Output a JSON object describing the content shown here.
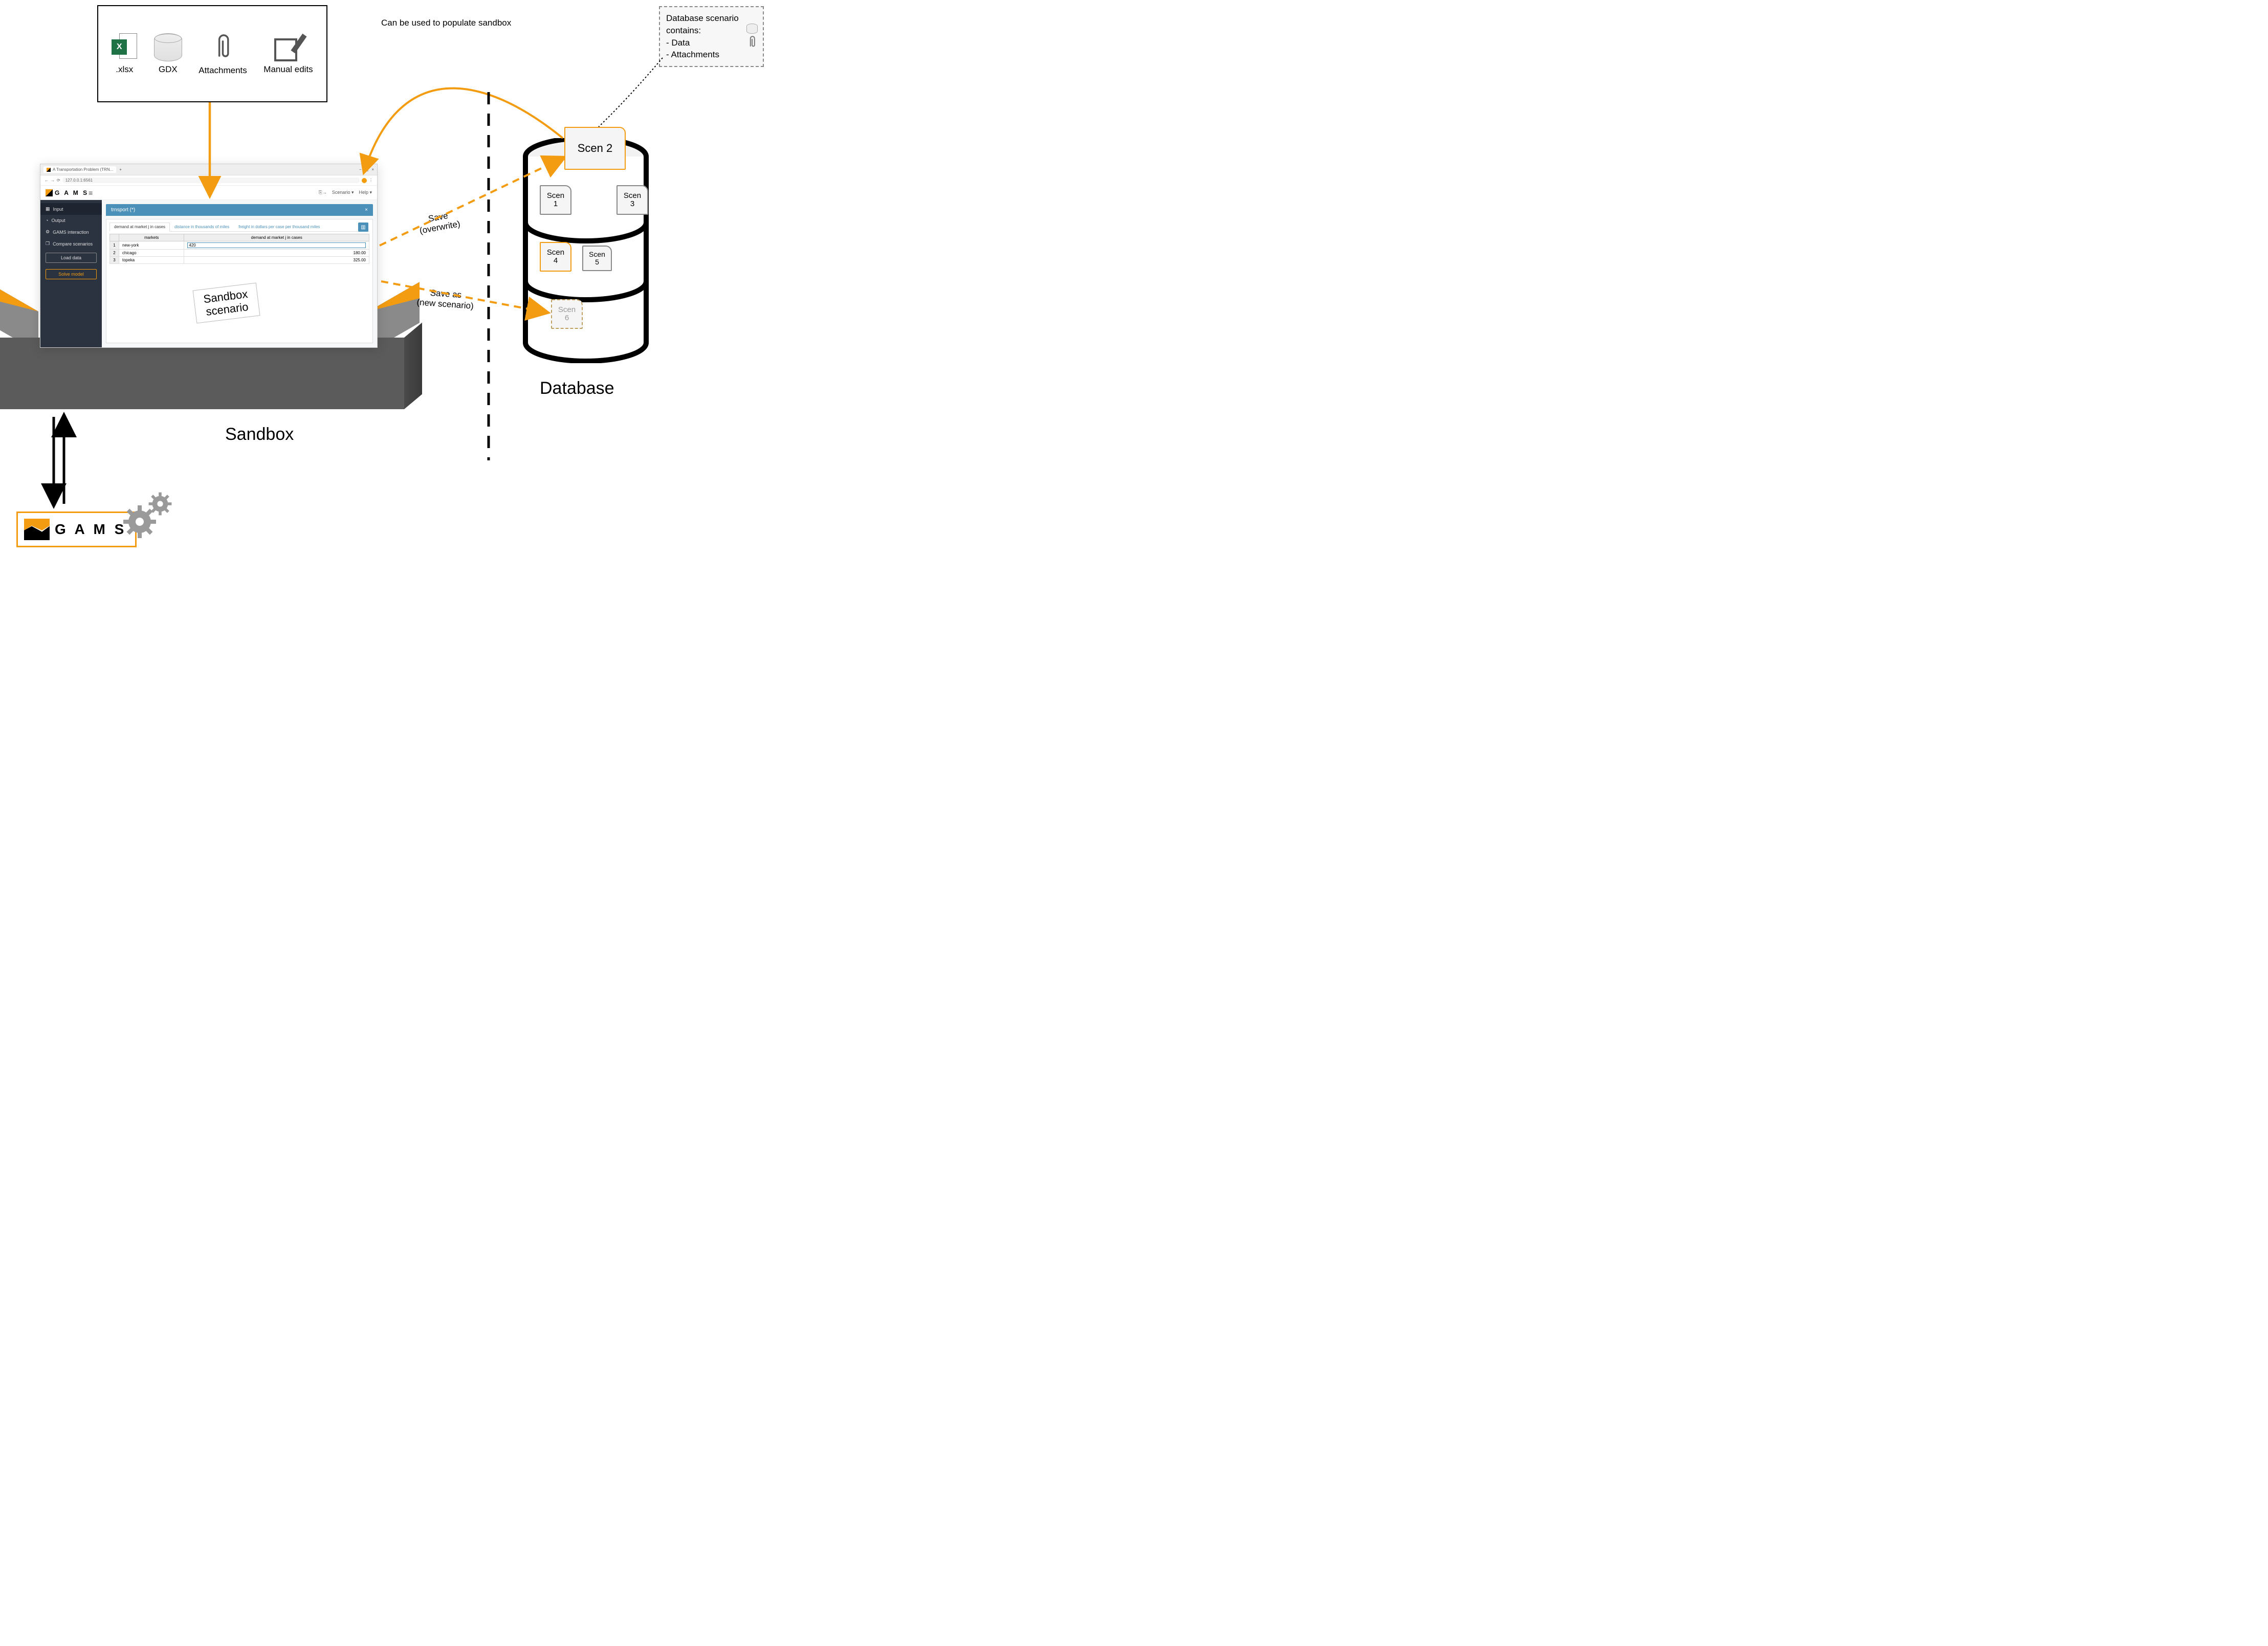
{
  "input_sources": {
    "xlsx_label": ".xlsx",
    "gdx_label": "GDX",
    "attachments_label": "Attachments",
    "manual_label": "Manual edits"
  },
  "db_callout": {
    "title": "Database scenario contains:",
    "item1": "Data",
    "item2": "Attachments"
  },
  "browser": {
    "tab_title": "A Transportation Problem (TRN...",
    "address": "127.0.0.1:6561",
    "brand": "G A M S",
    "hamburger": "≡",
    "header_solve_icon": "⎘→",
    "header_scenario": "Scenario ▾",
    "header_help": "Help ▾"
  },
  "sidebar": {
    "input": "Input",
    "output": "Output",
    "interaction": "GAMS interaction",
    "compare": "Compare scenarios",
    "load_btn": "Load data",
    "solve_btn": "Solve model"
  },
  "panel": {
    "title": "trnsport (*)",
    "close": "×",
    "chart_icon": "📊",
    "tab1": "demand at market j in cases",
    "tab2": "distance in thousands of miles",
    "tab3": "freight in dollars per case per thousand miles",
    "col_markets": "markets",
    "col_demand": "demand at market j in cases",
    "rows": [
      {
        "n": "1",
        "market": "new-york",
        "demand": "420"
      },
      {
        "n": "2",
        "market": "chicago",
        "demand": "180.00"
      },
      {
        "n": "3",
        "market": "topeka",
        "demand": "325.00"
      }
    ]
  },
  "sandbox_card": {
    "line1": "Sandbox",
    "line2": "scenario"
  },
  "scenarios": {
    "s2": "Scen 2",
    "s1_line1": "Scen",
    "s1_line2": "1",
    "s3_line1": "Scen",
    "s3_line2": "3",
    "s4_line1": "Scen",
    "s4_line2": "4",
    "s5_line1": "Scen",
    "s5_line2": "5",
    "s6_line1": "Scen",
    "s6_line2": "6"
  },
  "labels": {
    "sandbox": "Sandbox",
    "database": "Database",
    "populate": "Can be used to populate sandbox",
    "save_ov_line1": "Save",
    "save_ov_line2": "(overwrite)",
    "save_new_line1": "Save as",
    "save_new_line2": "(new scenario)"
  },
  "gams_box": {
    "text": "G A M S"
  }
}
